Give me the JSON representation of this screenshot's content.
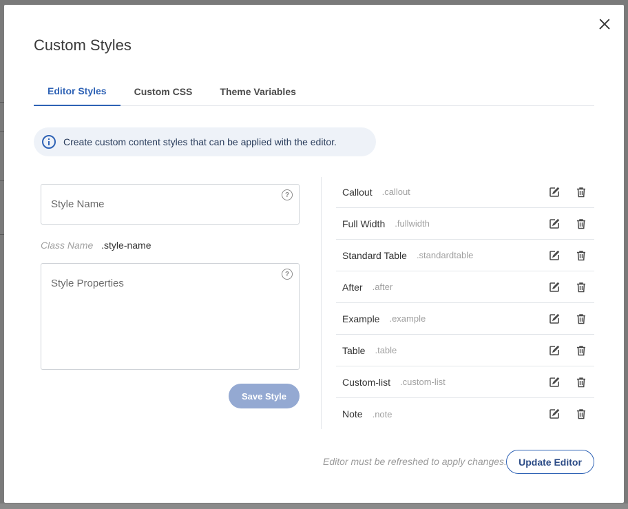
{
  "dialog": {
    "title": "Custom Styles"
  },
  "tabs": [
    {
      "label": "Editor Styles",
      "active": true
    },
    {
      "label": "Custom CSS",
      "active": false
    },
    {
      "label": "Theme Variables",
      "active": false
    }
  ],
  "info": {
    "icon": "info-icon",
    "text": "Create custom content styles that can be applied with the editor."
  },
  "form": {
    "style_name_placeholder": "Style Name",
    "class_name_label": "Class Name",
    "class_name_value": ".style-name",
    "style_properties_placeholder": "Style Properties",
    "help_glyph": "?",
    "save_label": "Save Style"
  },
  "styles": [
    {
      "name": "Callout",
      "class": ".callout"
    },
    {
      "name": "Full Width",
      "class": ".fullwidth"
    },
    {
      "name": "Standard Table",
      "class": ".standardtable"
    },
    {
      "name": "After",
      "class": ".after"
    },
    {
      "name": "Example",
      "class": ".example"
    },
    {
      "name": "Table",
      "class": ".table"
    },
    {
      "name": "Custom-list",
      "class": ".custom-list"
    },
    {
      "name": "Note",
      "class": ".note"
    }
  ],
  "footer": {
    "note": "Editor must be refreshed to apply changes.",
    "update_label": "Update Editor"
  },
  "colors": {
    "accent": "#2e62b5",
    "save_disabled": "#94a9d2"
  }
}
